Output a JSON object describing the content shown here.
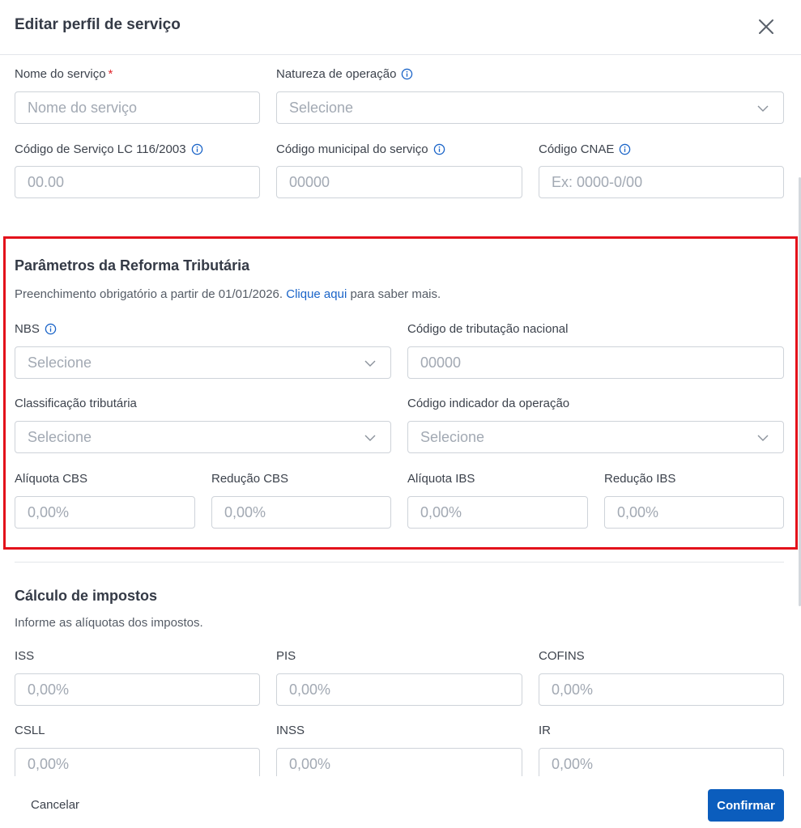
{
  "header": {
    "title": "Editar perfil de serviço"
  },
  "general": {
    "service_name": {
      "label": "Nome do serviço",
      "required_mark": "*",
      "placeholder": "Nome do serviço"
    },
    "operation_nature": {
      "label": "Natureza de operação",
      "placeholder": "Selecione"
    },
    "lc116_code": {
      "label": "Código de Serviço LC 116/2003",
      "placeholder": "00.00"
    },
    "municipal_code": {
      "label": "Código municipal do serviço",
      "placeholder": "00000"
    },
    "cnae_code": {
      "label": "Código CNAE",
      "placeholder": "Ex: 0000-0/00"
    }
  },
  "reform": {
    "title": "Parâmetros da Reforma Tributária",
    "desc_before": "Preenchimento obrigatório a partir de 01/01/2026.",
    "desc_link": "Clique aqui",
    "desc_after": "para saber mais.",
    "nbs": {
      "label": "NBS",
      "placeholder": "Selecione"
    },
    "national_code": {
      "label": "Código de tributação nacional",
      "placeholder": "00000"
    },
    "tax_classification": {
      "label": "Classificação tributária",
      "placeholder": "Selecione"
    },
    "operation_indicator": {
      "label": "Código indicador da operação",
      "placeholder": "Selecione"
    },
    "cbs_rate": {
      "label": "Alíquota CBS",
      "placeholder": "0,00%"
    },
    "cbs_reduction": {
      "label": "Redução CBS",
      "placeholder": "0,00%"
    },
    "ibs_rate": {
      "label": "Alíquota IBS",
      "placeholder": "0,00%"
    },
    "ibs_reduction": {
      "label": "Redução IBS",
      "placeholder": "0,00%"
    }
  },
  "taxes": {
    "title": "Cálculo de impostos",
    "desc": "Informe as alíquotas dos impostos.",
    "iss": {
      "label": "ISS",
      "placeholder": "0,00%"
    },
    "pis": {
      "label": "PIS",
      "placeholder": "0,00%"
    },
    "cofins": {
      "label": "COFINS",
      "placeholder": "0,00%"
    },
    "csll": {
      "label": "CSLL",
      "placeholder": "0,00%"
    },
    "inss": {
      "label": "INSS",
      "placeholder": "0,00%"
    },
    "ir": {
      "label": "IR",
      "placeholder": "0,00%"
    }
  },
  "footer": {
    "cancel_label": "Cancelar",
    "confirm_label": "Confirmar"
  },
  "icons": {
    "close": "close-icon",
    "info": "info-icon",
    "dropdown": "chevron-down-icon"
  },
  "colors": {
    "primary": "#0b5dbd",
    "link": "#1a64c8",
    "highlight": "#e3121b",
    "required": "#e0282e"
  }
}
